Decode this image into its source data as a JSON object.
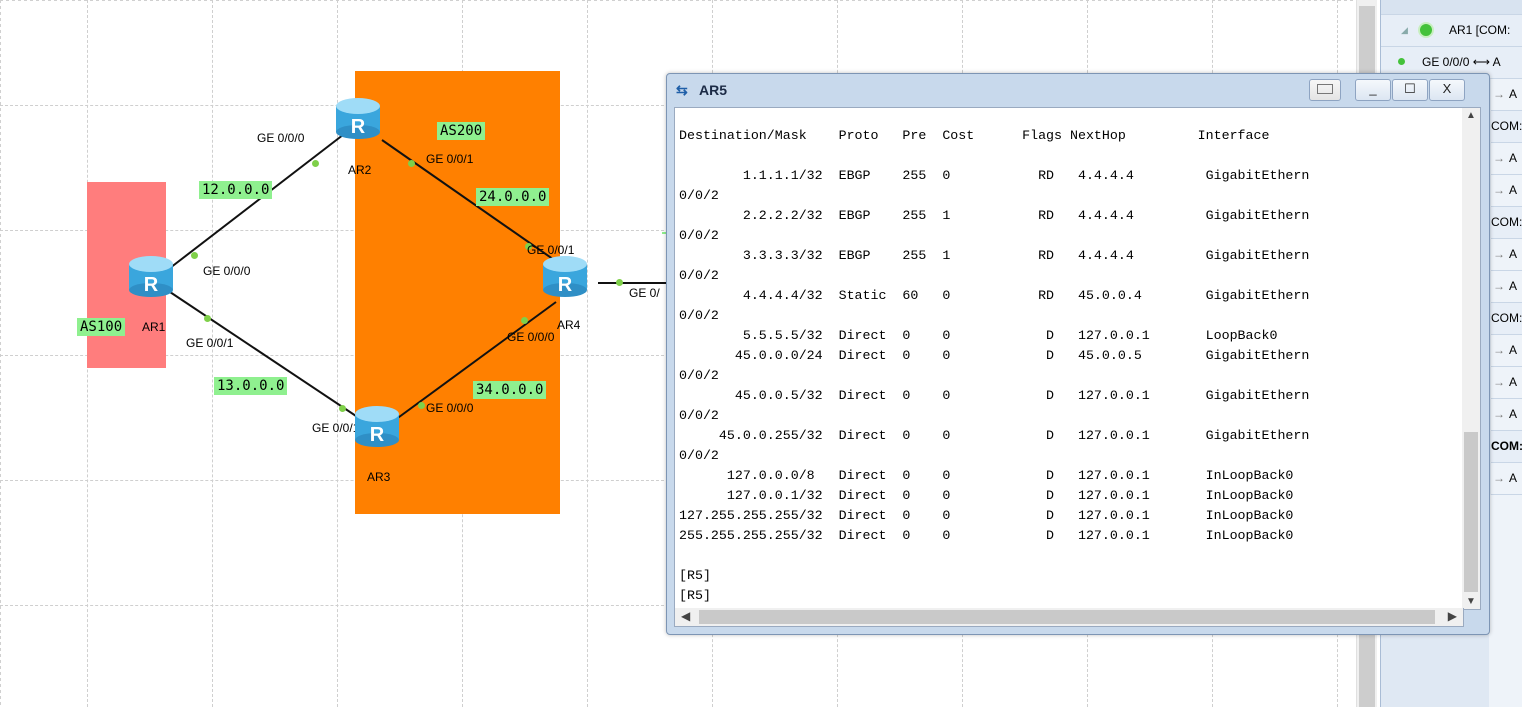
{
  "topology": {
    "areas": [
      {
        "label": "AS100",
        "color": "#ff7d7d"
      },
      {
        "label": "AS200",
        "color": "#ff8000"
      }
    ],
    "networks": [
      "12.0.0.0",
      "13.0.0.0",
      "24.0.0.0",
      "34.0.0.0"
    ],
    "devices": [
      "AR1",
      "AR2",
      "AR3",
      "AR4"
    ],
    "interfaces": {
      "ar2_left": "GE 0/0/0",
      "ar2_right": "GE 0/0/1",
      "ar1_top": "GE 0/0/0",
      "ar1_bottom": "GE 0/0/1",
      "ar3_left": "GE 0/0/1",
      "ar3_right": "GE 0/0/0",
      "ar4_top": "GE 0/0/1",
      "ar4_bottom": "GE 0/0/0",
      "ar4_right": "GE 0/"
    }
  },
  "terminal": {
    "title": "AR5",
    "icon": "terminal-icon",
    "buttons": {
      "minimize": "_",
      "maximize": "☐",
      "close": "X"
    },
    "lines": [
      "Destination/Mask    Proto   Pre  Cost      Flags NextHop         Interface",
      "",
      "        1.1.1.1/32  EBGP    255  0           RD   4.4.4.4         GigabitEthern",
      "0/0/2",
      "        2.2.2.2/32  EBGP    255  1           RD   4.4.4.4         GigabitEthern",
      "0/0/2",
      "        3.3.3.3/32  EBGP    255  1           RD   4.4.4.4         GigabitEthern",
      "0/0/2",
      "        4.4.4.4/32  Static  60   0           RD   45.0.0.4        GigabitEthern",
      "0/0/2",
      "        5.5.5.5/32  Direct  0    0            D   127.0.0.1       LoopBack0",
      "       45.0.0.0/24  Direct  0    0            D   45.0.0.5        GigabitEthern",
      "0/0/2",
      "       45.0.0.5/32  Direct  0    0            D   127.0.0.1       GigabitEthern",
      "0/0/2",
      "     45.0.0.255/32  Direct  0    0            D   127.0.0.1       GigabitEthern",
      "0/0/2",
      "      127.0.0.0/8   Direct  0    0            D   127.0.0.1       InLoopBack0",
      "      127.0.0.1/32  Direct  0    0            D   127.0.0.1       InLoopBack0",
      "127.255.255.255/32  Direct  0    0            D   127.0.0.1       InLoopBack0",
      "255.255.255.255/32  Direct  0    0            D   127.0.0.1       InLoopBack0",
      "",
      "[R5]",
      "[R5]"
    ]
  },
  "panel": {
    "top_item": "AR1 [COM:",
    "link_item": "GE 0/0/0 ⟷ A",
    "com_label": "COM:",
    "com_label_bold": "COM:",
    "arrow_item": "A"
  }
}
